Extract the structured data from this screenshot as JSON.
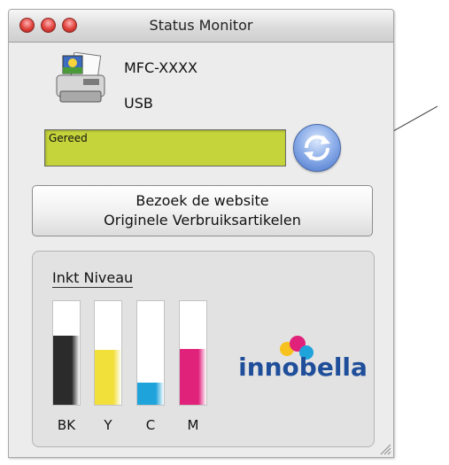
{
  "window": {
    "title": "Status Monitor"
  },
  "device": {
    "model": "MFC-XXXX",
    "connection": "USB"
  },
  "status": {
    "text": "Gereed",
    "color": "#c4d43a"
  },
  "buttons": {
    "visit_line1": "Bezoek de website",
    "visit_line2": "Originele Verbruiksartikelen"
  },
  "ink": {
    "title": "Inkt Niveau",
    "cartridges": [
      {
        "label": "BK",
        "color": "#2b2b2b",
        "level": 0.67
      },
      {
        "label": "Y",
        "color": "#f2e03a",
        "level": 0.53
      },
      {
        "label": "C",
        "color": "#1fa3db",
        "level": 0.21
      },
      {
        "label": "M",
        "color": "#e0227b",
        "level": 0.54
      }
    ]
  },
  "brand": {
    "logo_text": "innobella"
  },
  "icons": [
    "close-light-icon",
    "minimize-light-icon",
    "zoom-light-icon",
    "printer-icon",
    "refresh-icon",
    "resize-grip-icon"
  ]
}
